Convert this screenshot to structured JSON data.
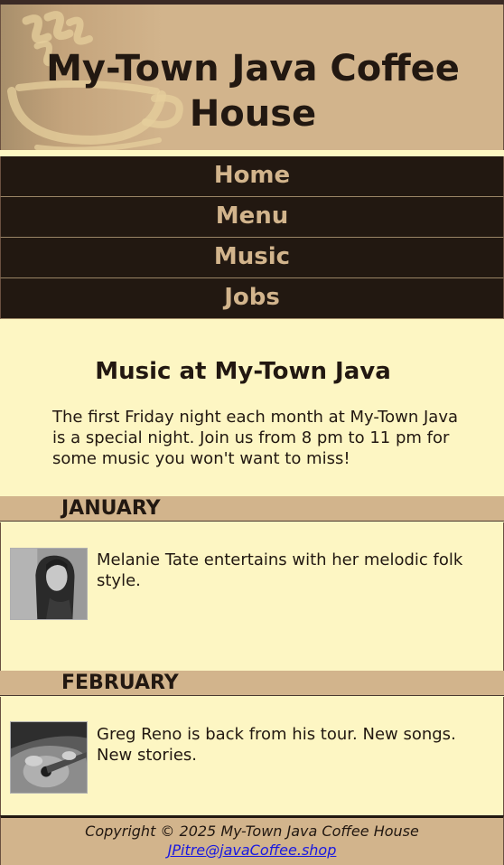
{
  "header": {
    "title": "My-Town Java Coffee House",
    "logo_icon": "coffee-cup-icon"
  },
  "nav": {
    "items": [
      {
        "label": "Home"
      },
      {
        "label": "Menu"
      },
      {
        "label": "Music"
      },
      {
        "label": "Jobs"
      }
    ]
  },
  "main": {
    "heading": "Music at My-Town Java",
    "intro": "The first Friday night each month at My-Town Java is a special night. Join us from 8 pm to 11 pm for some music you won't want to miss!",
    "events": [
      {
        "month": "JANUARY",
        "description": "Melanie Tate entertains with her melodic folk style.",
        "photo_icon": "singer-photo"
      },
      {
        "month": "FEBRUARY",
        "description": "Greg Reno is back from his tour. New songs. New stories.",
        "photo_icon": "guitarist-photo"
      }
    ]
  },
  "footer": {
    "copyright": "Copyright © 2025 My-Town Java Coffee House",
    "email": "JPitre@javaCoffee.shop"
  },
  "colors": {
    "page_background": "#fdf6c3",
    "header_tan": "#d2b48c",
    "nav_dark": "#221811",
    "nav_text": "#d2b48c",
    "link_blue": "#1a1ae0"
  }
}
